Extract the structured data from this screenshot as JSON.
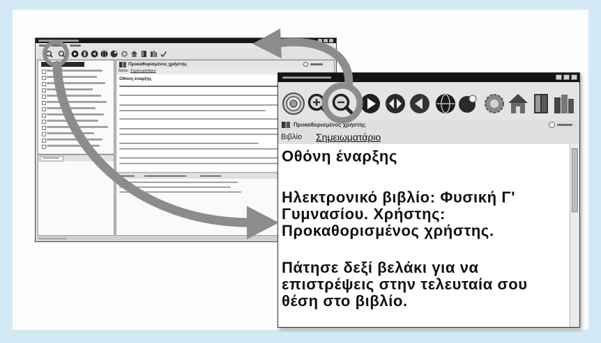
{
  "background_window": {
    "header_user": "Προκαθορισμένος χρήστης",
    "tabs": [
      "Βιβλίο",
      "Σημειωματάριο"
    ],
    "content_heading": "Οθόνη έναρξης",
    "toolbar_icons": [
      "zoom-in-icon",
      "zoom-out-icon",
      "play-forward-icon",
      "double-arrow-icon",
      "back-icon",
      "globe-icon",
      "sphere-icon",
      "gear-icon",
      "home-icon",
      "door-icon",
      "bookshelf-icon",
      "check-icon"
    ]
  },
  "foreground_window": {
    "header_user": "Προκαθορισμένος χρήστης",
    "tabs": [
      "Βιβλίο",
      "Σημειωματάριο"
    ],
    "content": {
      "heading": "Οθόνη έναρξης",
      "paragraph1": [
        "Ηλεκτρονικό βιβλίο: Φυσική Γ'",
        "Γυμνασίου. Χρήστης:",
        "Προκαθορισμένος χρήστης."
      ],
      "paragraph2": [
        "Πάτησε δεξί βελάκι για να",
        "επιστρέψεις στην τελευταία σου",
        "θέση στο βιβλίο."
      ]
    },
    "toolbar_icons": [
      "target-icon",
      "zoom-in-icon",
      "zoom-out-icon",
      "play-forward-icon",
      "double-arrow-icon",
      "back-icon",
      "globe-icon",
      "sphere-icon",
      "gear-icon",
      "home-icon",
      "door-icon",
      "bookshelf-icon"
    ]
  },
  "colors": {
    "frame": "#d3e9f5",
    "arrow": "#8c8c8c",
    "title_bar": "#141414"
  }
}
